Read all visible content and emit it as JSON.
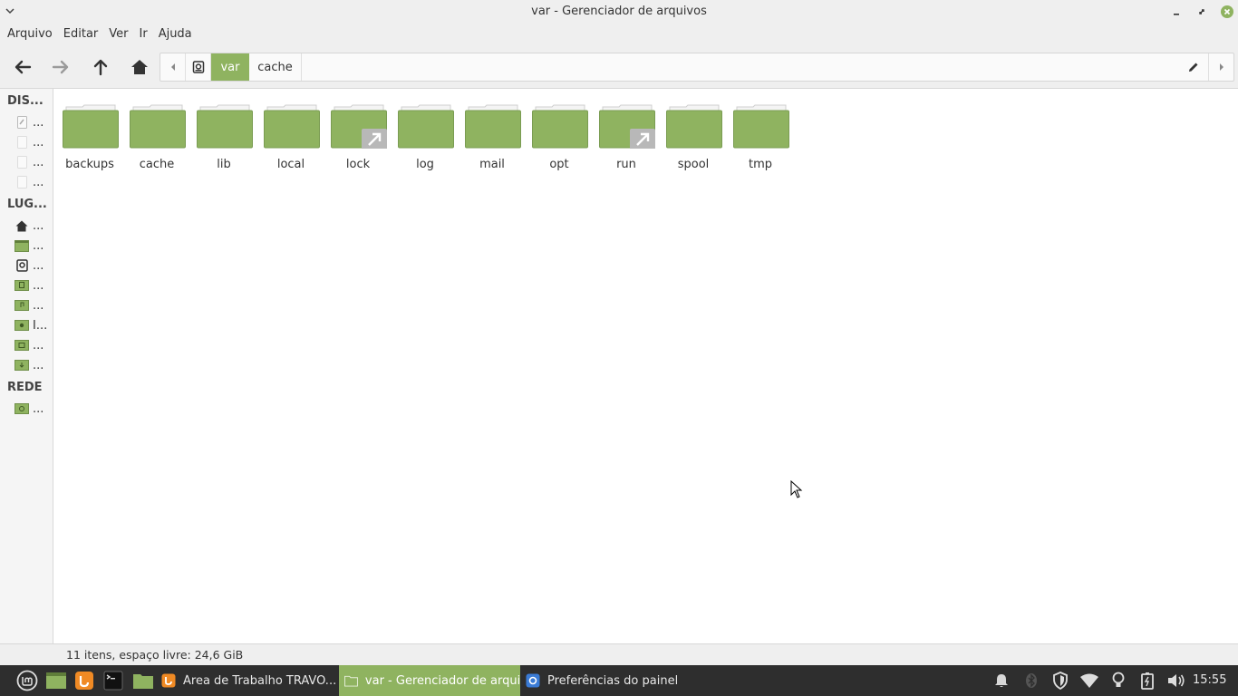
{
  "window": {
    "title": "var - Gerenciador de arquivos"
  },
  "menu": {
    "items": [
      "Arquivo",
      "Editar",
      "Ver",
      "Ir",
      "Ajuda"
    ]
  },
  "pathbar": {
    "segments": [
      "var",
      "cache"
    ],
    "active_segment": "var"
  },
  "sidebar": {
    "sections": {
      "devices": "DIS...",
      "places": "LUG...",
      "network": "REDE"
    },
    "devices": [
      {
        "icon": "drive-icon",
        "label": "..."
      },
      {
        "icon": "drive-icon",
        "label": "..."
      },
      {
        "icon": "drive-icon",
        "label": "..."
      },
      {
        "icon": "drive-icon",
        "label": "..."
      }
    ],
    "places": [
      {
        "icon": "home-icon",
        "label": "..."
      },
      {
        "icon": "desktop-icon",
        "label": "..."
      },
      {
        "icon": "root-drive-icon",
        "label": "..."
      },
      {
        "icon": "documents-folder-icon",
        "label": "..."
      },
      {
        "icon": "music-folder-icon",
        "label": "..."
      },
      {
        "icon": "pictures-folder-icon",
        "label": "I..."
      },
      {
        "icon": "videos-folder-icon",
        "label": "..."
      },
      {
        "icon": "downloads-folder-icon",
        "label": "..."
      }
    ],
    "network": [
      {
        "icon": "network-folder-icon",
        "label": "..."
      }
    ]
  },
  "files": [
    {
      "name": "backups",
      "symlink": false
    },
    {
      "name": "cache",
      "symlink": false
    },
    {
      "name": "lib",
      "symlink": false
    },
    {
      "name": "local",
      "symlink": false
    },
    {
      "name": "lock",
      "symlink": true
    },
    {
      "name": "log",
      "symlink": false
    },
    {
      "name": "mail",
      "symlink": false
    },
    {
      "name": "opt",
      "symlink": false
    },
    {
      "name": "run",
      "symlink": true
    },
    {
      "name": "spool",
      "symlink": false
    },
    {
      "name": "tmp",
      "symlink": false
    }
  ],
  "statusbar": {
    "text": "11 itens, espaço livre: 24,6 GiB"
  },
  "taskbar": {
    "tasks": [
      {
        "label": "Área de Trabalho TRAVO...",
        "icon": "firefox-icon",
        "active": false
      },
      {
        "label": "var - Gerenciador de arqui...",
        "icon": "folder-icon",
        "active": true
      },
      {
        "label": "Preferências do painel",
        "icon": "preferences-icon",
        "active": false
      }
    ],
    "clock": "15:55"
  },
  "colors": {
    "accent": "#8fb360",
    "folder_tab": "#f4f4f4",
    "taskbar_bg": "#2e2e2e"
  }
}
